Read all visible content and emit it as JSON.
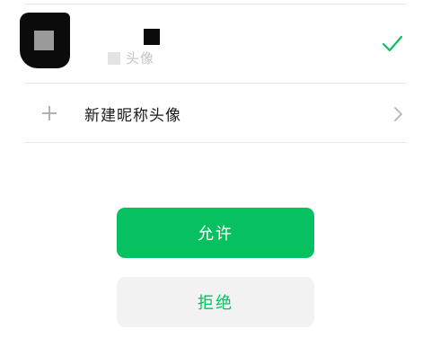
{
  "account_option": {
    "label": "头像",
    "selected": true
  },
  "create_option": {
    "label": "新建昵称头像"
  },
  "actions": {
    "allow_label": "允许",
    "deny_label": "拒绝"
  },
  "colors": {
    "accent": "#07c160",
    "deny_bg": "#f2f2f2"
  },
  "icons": {
    "check": "check-icon",
    "plus": "plus-icon",
    "chevron": "chevron-right-icon"
  }
}
